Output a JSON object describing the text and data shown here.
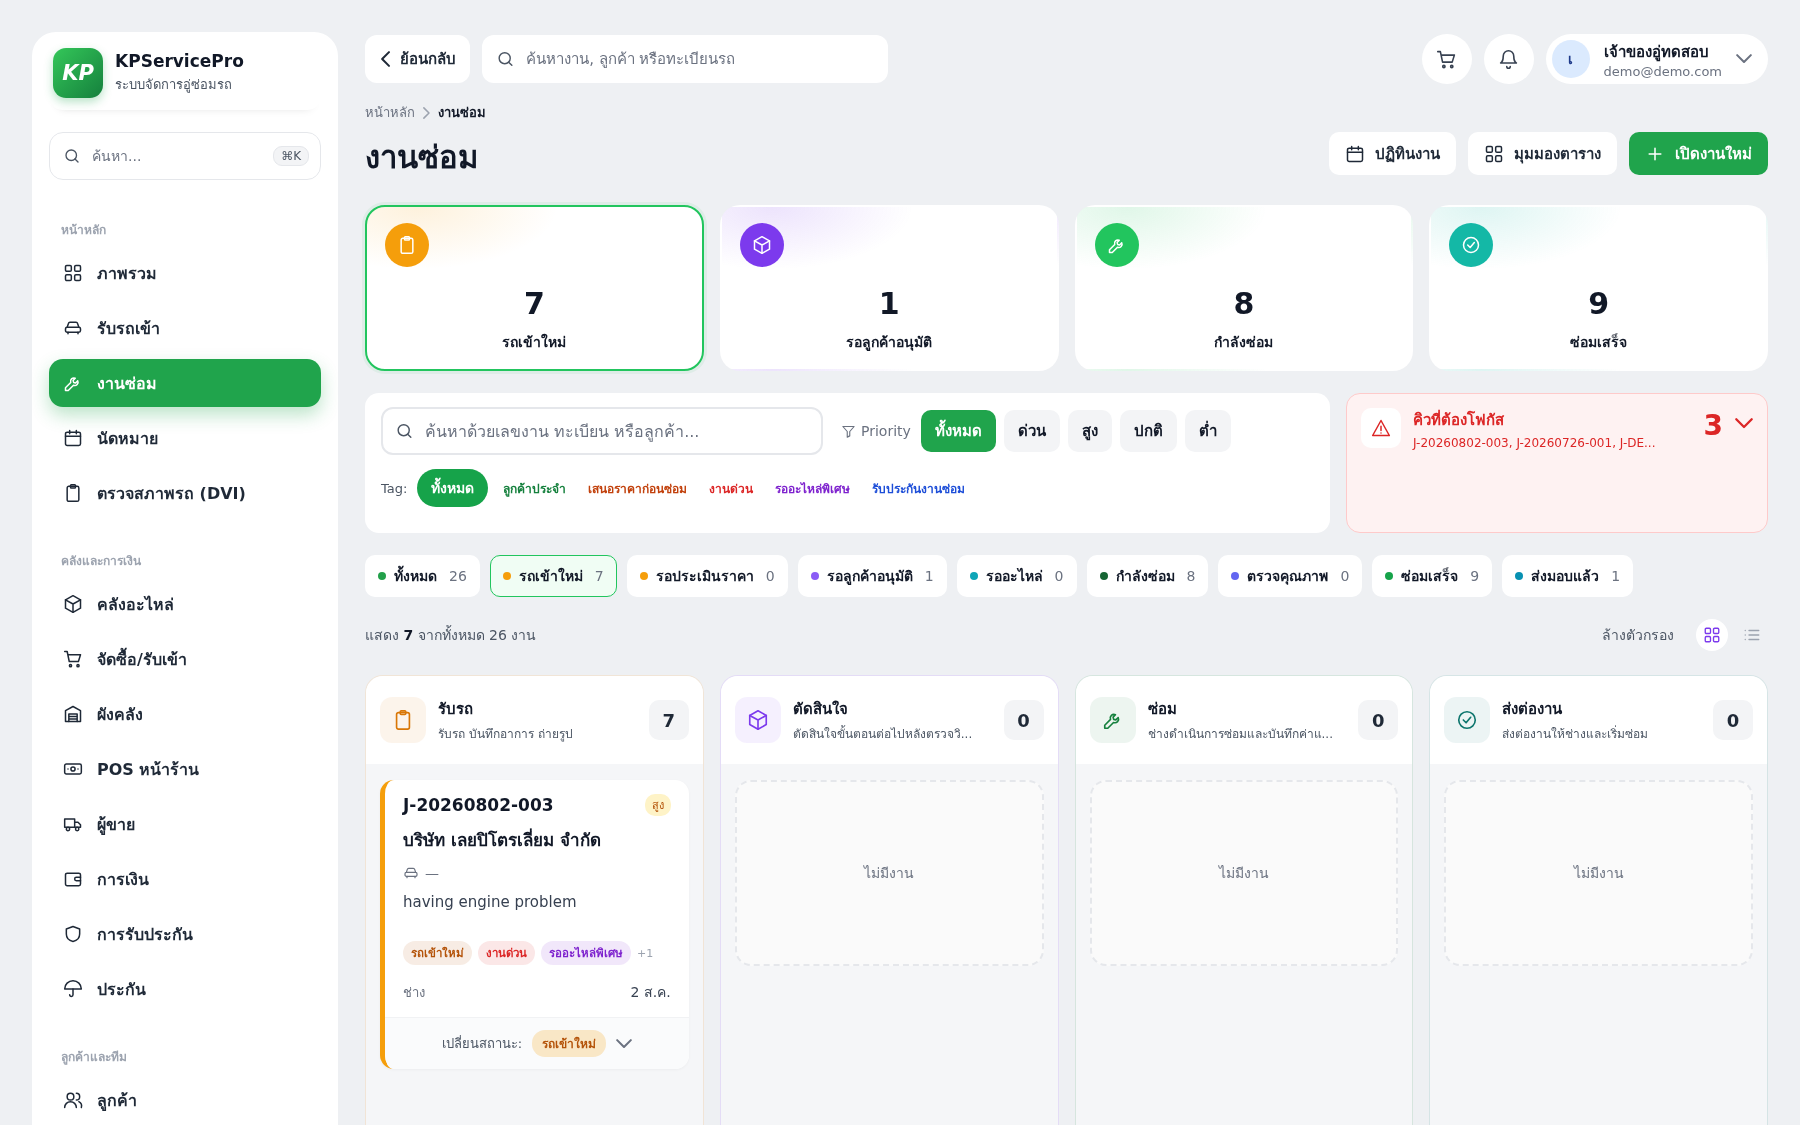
{
  "sidebar": {
    "brand": {
      "logo": "KP",
      "name": "KPServicePro",
      "subtitle": "ระบบจัดการอู่ซ่อมรถ"
    },
    "search": {
      "placeholder": "ค้นหา...",
      "shortcut": "⌘K"
    },
    "sections": [
      {
        "title": "หน้าหลัก",
        "items": [
          {
            "label": "ภาพรวม",
            "selected": false
          },
          {
            "label": "รับรถเข้า",
            "selected": false
          },
          {
            "label": "งานซ่อม",
            "selected": true
          },
          {
            "label": "นัดหมาย",
            "selected": false
          },
          {
            "label": "ตรวจสภาพรถ (DVI)",
            "selected": false
          }
        ]
      },
      {
        "title": "คลังและการเงิน",
        "items": [
          {
            "label": "คลังอะไหล่",
            "selected": false
          },
          {
            "label": "จัดซื้อ/รับเข้า",
            "selected": false
          },
          {
            "label": "ผังคลัง",
            "selected": false
          },
          {
            "label": "POS หน้าร้าน",
            "selected": false
          },
          {
            "label": "ผู้ขาย",
            "selected": false
          },
          {
            "label": "การเงิน",
            "selected": false
          },
          {
            "label": "การรับประกัน",
            "selected": false
          },
          {
            "label": "ประกัน",
            "selected": false
          }
        ]
      },
      {
        "title": "ลูกค้าและทีม",
        "items": [
          {
            "label": "ลูกค้า",
            "selected": false
          }
        ]
      }
    ]
  },
  "topbar": {
    "back": "ย้อนกลับ",
    "search": {
      "placeholder": "ค้นหางาน, ลูกค้า หรือทะเบียนรถ"
    },
    "user": {
      "initial": "เ",
      "name": "เจ้าของอู่ทดสอบ",
      "email": "demo@demo.com"
    }
  },
  "breadcrumb": [
    "หน้าหลัก",
    "งานซ่อม"
  ],
  "title": "งานซ่อม",
  "actions": [
    {
      "label": "ปฏิทินงาน",
      "kind": "secondary"
    },
    {
      "label": "มุมมองตาราง",
      "kind": "secondary"
    },
    {
      "label": "เปิดงานใหม่",
      "kind": "primary"
    }
  ],
  "stats": [
    {
      "value": "7",
      "label": "รถเข้าใหม่",
      "color": "#f59e0b",
      "selected": true
    },
    {
      "value": "1",
      "label": "รอลูกค้าอนุมัติ",
      "color": "#7c3aed",
      "selected": false
    },
    {
      "value": "8",
      "label": "กำลังซ่อม",
      "color": "#22c55e",
      "selected": false
    },
    {
      "value": "9",
      "label": "ซ่อมเสร็จ",
      "color": "#14b8a6",
      "selected": false
    }
  ],
  "filters": {
    "search": {
      "placeholder": "ค้นหาด้วยเลขงาน ทะเบียน หรือลูกค้า..."
    },
    "priority_label": "Priority",
    "priorities": [
      {
        "label": "ทั้งหมด",
        "selected": true
      },
      {
        "label": "ด่วน",
        "selected": false
      },
      {
        "label": "สูง",
        "selected": false
      },
      {
        "label": "ปกติ",
        "selected": false
      },
      {
        "label": "ต่ำ",
        "selected": false
      }
    ],
    "tag_label": "Tag:",
    "tags": [
      {
        "label": "ทั้งหมด",
        "color": "#16a34a",
        "selected": true
      },
      {
        "label": "ลูกค้าประจำ",
        "color": "#15803d",
        "selected": false
      },
      {
        "label": "เสนอราคาก่อนซ่อม",
        "color": "#c2410c",
        "selected": false
      },
      {
        "label": "งานด่วน",
        "color": "#dc2626",
        "selected": false
      },
      {
        "label": "รออะไหล่พิเศษ",
        "color": "#7e22ce",
        "selected": false
      },
      {
        "label": "รับประกันงานซ่อม",
        "color": "#1d4ed8",
        "selected": false
      }
    ]
  },
  "focus": {
    "title": "คิวที่ต้องโฟกัส",
    "jobs": "J-20260802-003, J-20260726-001, J-DE...",
    "count": "3"
  },
  "status_chips": [
    {
      "label": "ทั้งหมด",
      "count": "26",
      "color": "#22a04a",
      "selected": false
    },
    {
      "label": "รถเข้าใหม่",
      "count": "7",
      "color": "#f59e0b",
      "selected": true
    },
    {
      "label": "รอประเมินราคา",
      "count": "0",
      "color": "#f59e0b",
      "selected": false
    },
    {
      "label": "รอลูกค้าอนุมัติ",
      "count": "1",
      "color": "#8b5cf6",
      "selected": false
    },
    {
      "label": "รออะไหล่",
      "count": "0",
      "color": "#0ea5b7",
      "selected": false
    },
    {
      "label": "กำลังซ่อม",
      "count": "8",
      "color": "#166534",
      "selected": false
    },
    {
      "label": "ตรวจคุณภาพ",
      "count": "0",
      "color": "#6366f1",
      "selected": false
    },
    {
      "label": "ซ่อมเสร็จ",
      "count": "9",
      "color": "#16a34a",
      "selected": false
    },
    {
      "label": "ส่งมอบแล้ว",
      "count": "1",
      "color": "#0891b2",
      "selected": false
    }
  ],
  "summary": {
    "text": "แสดง **7** จากทั้งหมด 26 งาน",
    "clear": "ล้างตัวกรอง",
    "views": [
      {
        "selected": true
      },
      {
        "selected": false
      }
    ]
  },
  "columns": [
    {
      "title": "รับรถ",
      "subtitle": "รับรถ บันทึกอาการ ถ่ายรูป",
      "count": "7",
      "color": "#d97706",
      "cards": [
        {
          "job": "J-20260802-003",
          "priority": "สูง",
          "customer": "บริษัท เลยปิโตรเลี่ยม จำกัด",
          "plate": "—",
          "problem": "having engine problem",
          "tags": [
            {
              "label": "รถเข้าใหม่",
              "color": "#b45309"
            },
            {
              "label": "งานด่วน",
              "color": "#dc2626"
            },
            {
              "label": "รออะไหล่พิเศษ",
              "color": "#7e22ce"
            }
          ],
          "more": "+1",
          "technician": "ช่าง",
          "date": "2 ส.ค.",
          "status_label": "เปลี่ยนสถานะ:",
          "status": "รถเข้าใหม่",
          "color": "#f59e0b"
        }
      ]
    },
    {
      "title": "ตัดสินใจ",
      "subtitle": "ตัดสินใจขั้นตอนต่อไปหลังตรวจวิ...",
      "count": "0",
      "color": "#7c3aed",
      "empty": "ไม่มีงาน"
    },
    {
      "title": "ซ่อม",
      "subtitle": "ช่างดำเนินการซ่อมและบันทึกค่าแ...",
      "count": "0",
      "color": "#15803d",
      "empty": "ไม่มีงาน"
    },
    {
      "title": "ส่งต่องาน",
      "subtitle": "ส่งต่องานให้ช่างและเริ่มซ่อม",
      "count": "0",
      "color": "#0f766e",
      "empty": "ไม่มีงาน"
    }
  ]
}
